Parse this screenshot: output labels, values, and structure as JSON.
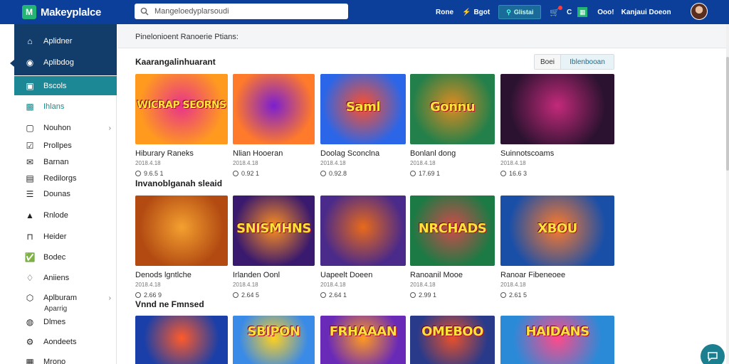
{
  "header": {
    "brand": "Makeyplalce",
    "search_placeholder": "Mangeloedyplarsoudi",
    "nav": [
      "Rone",
      "Bgot"
    ],
    "pill": "Glistai",
    "cart_count": "C",
    "user_name": "Ooo!",
    "user_sub": "Kanjaui Doeon"
  },
  "sidebar": {
    "items": [
      {
        "label": "Aplidner",
        "icon": "home-icon"
      },
      {
        "label": "Aplibdog",
        "icon": "compass-icon"
      },
      {
        "label": "Bscols",
        "icon": "square-icon"
      },
      {
        "label": "Ihlans",
        "icon": "controller-icon"
      },
      {
        "label": "Nouhon",
        "icon": "box-icon"
      },
      {
        "label": "Prollpes",
        "icon": "check-box-icon"
      },
      {
        "label": "Barnan",
        "icon": "mail-icon"
      },
      {
        "label": "Redilorgs",
        "icon": "doc-icon"
      },
      {
        "label": "Dounas",
        "icon": "list-icon"
      },
      {
        "label": "Rnlode",
        "icon": "person-icon"
      },
      {
        "label": "Heider",
        "icon": "bracket-icon"
      },
      {
        "label": "Bodec",
        "icon": "checked-icon"
      },
      {
        "label": "Aniiens",
        "icon": "tag-icon"
      },
      {
        "label": "Aplburam",
        "icon": "hex-icon"
      },
      {
        "label": "Dlmes",
        "icon": "gamepad-icon"
      },
      {
        "label": "Aondeets",
        "icon": "gear-icon"
      },
      {
        "label": "Mrono",
        "icon": "grid-icon"
      }
    ],
    "sub_label": "Aparrig"
  },
  "main": {
    "breadcrumb": "Pinelonioent Ranoerie Ptians:",
    "toggle": {
      "off": "Boei",
      "on": "Iblenbooan"
    },
    "sections": [
      {
        "title": "Kaarangalinhuarant",
        "cards": [
          {
            "title": "Hiburary Raneks",
            "meta": "2018.4.18",
            "price": "9.6.5 1",
            "art": "WICRAP SEORNS",
            "bg": "#ff9a1f",
            "bg2": "#e8338a"
          },
          {
            "title": "Nlian Hooeran",
            "meta": "2018.4.18",
            "price": "0.92 1",
            "art": "",
            "bg": "#ff7a2a",
            "bg2": "#7b1fd1"
          },
          {
            "title": "Doolag Sconclna",
            "meta": "2018.4.18",
            "price": "0.92.8",
            "art": "Saml",
            "bg": "#2b66e8",
            "bg2": "#ff4f2a"
          },
          {
            "title": "Bonlanl dong",
            "meta": "2018.4.18",
            "price": "17.69 1",
            "art": "Gonnu",
            "bg": "#23804a",
            "bg2": "#e08b20"
          },
          {
            "title": "Suinnotscoams",
            "meta": "2018.4.18",
            "price": "16.6 3",
            "art": "",
            "bg": "#2a1230",
            "bg2": "#c32a7a"
          }
        ]
      },
      {
        "title": "Invanoblganah sleaid",
        "cards": [
          {
            "title": "Denods lgntlche",
            "meta": "2018.4.18",
            "price": "2.66 9",
            "art": "",
            "bg": "#b24a12",
            "bg2": "#f4a030"
          },
          {
            "title": "Irlanden Oonl",
            "meta": "2018.4.18",
            "price": "2.64 5",
            "art": "SNISMHNS",
            "bg": "#3a1a6e",
            "bg2": "#ff9020"
          },
          {
            "title": "Uapeelt Doeen",
            "meta": "2018.4.18",
            "price": "2.64 1",
            "art": "",
            "bg": "#4a2a8a",
            "bg2": "#e86a1a"
          },
          {
            "title": "Ranoanil Mooe",
            "meta": "2018.4.18",
            "price": "2.99 1",
            "art": "NRCHADS",
            "bg": "#1c7a44",
            "bg2": "#d04a4a"
          },
          {
            "title": "Ranoar Fibeneoee",
            "meta": "2018.4.18",
            "price": "2.61 5",
            "art": "XBOU",
            "bg": "#1a4fa8",
            "bg2": "#ff7a2a"
          }
        ]
      },
      {
        "title": "Vnnd ne Fmnsed",
        "cards": [
          {
            "title": "",
            "meta": "",
            "price": "",
            "art": "",
            "bg": "#1a3fa8",
            "bg2": "#ff5a2a"
          },
          {
            "title": "",
            "meta": "",
            "price": "",
            "art": "SBIPON",
            "bg": "#3a8ae8",
            "bg2": "#ffd020"
          },
          {
            "title": "",
            "meta": "",
            "price": "",
            "art": "FRHAAAN",
            "bg": "#6a2ab8",
            "bg2": "#ff9a20"
          },
          {
            "title": "",
            "meta": "",
            "price": "",
            "art": "OMEBOO",
            "bg": "#2a3a8a",
            "bg2": "#e8502a"
          },
          {
            "title": "",
            "meta": "",
            "price": "",
            "art": "HAIDANS",
            "bg": "#2a8ad8",
            "bg2": "#ff4a8a"
          }
        ]
      }
    ]
  }
}
